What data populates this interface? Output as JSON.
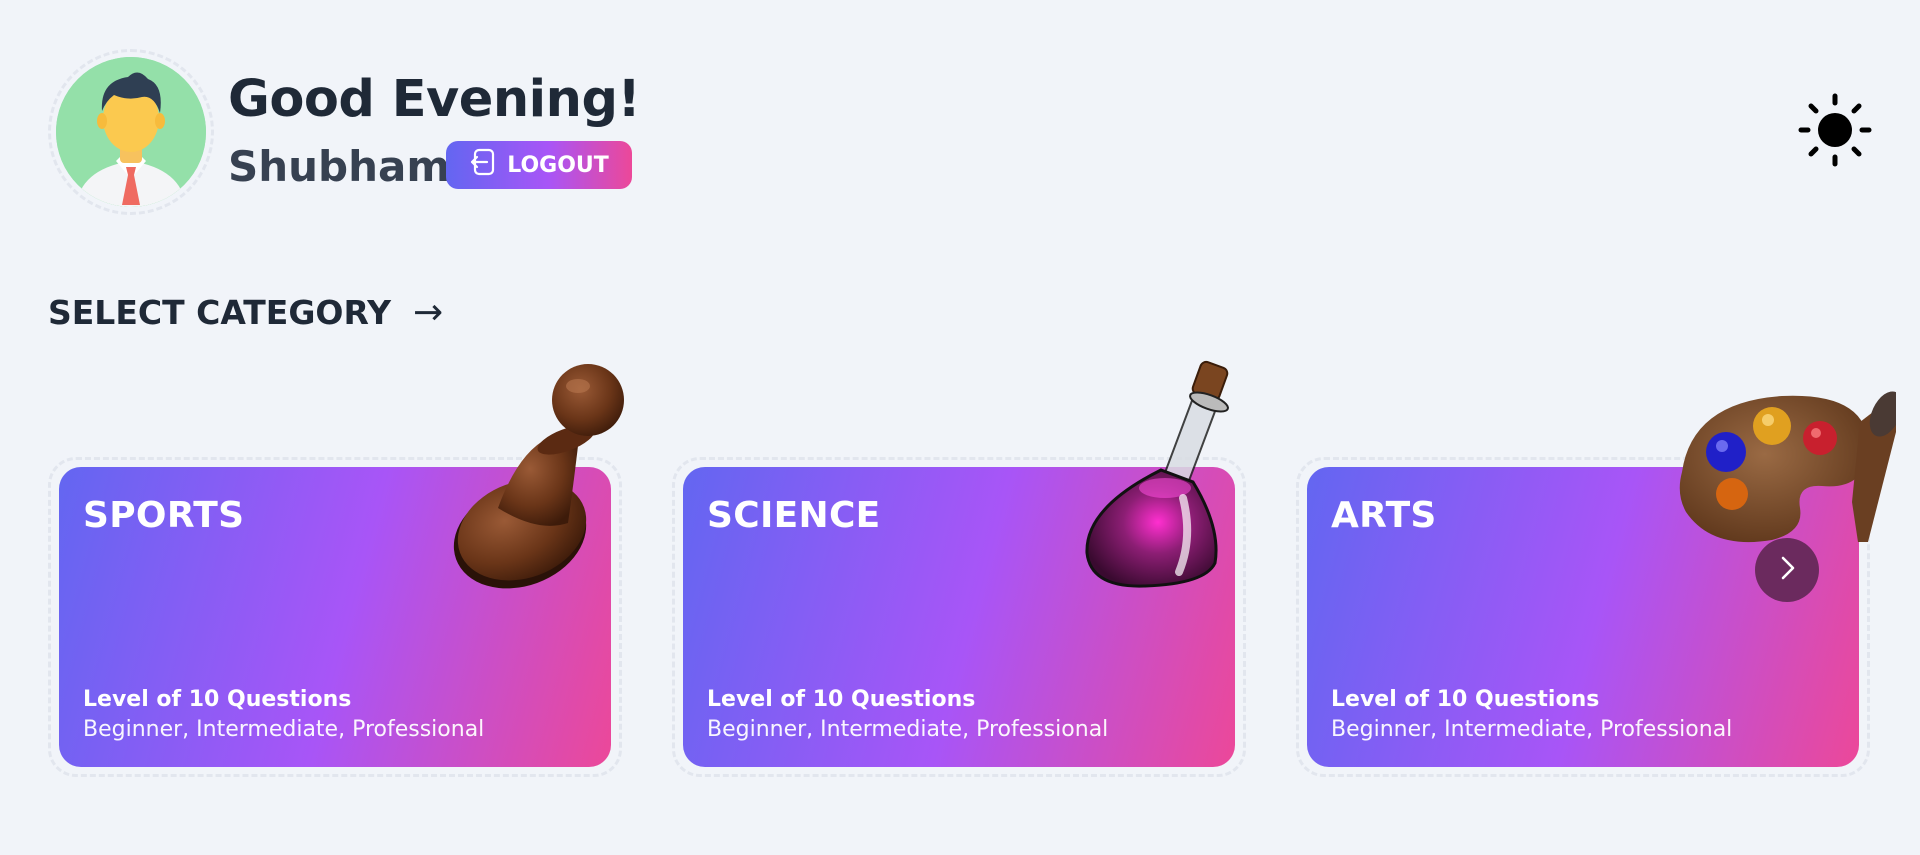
{
  "header": {
    "greeting": "Good Evening!",
    "username": "Shubham",
    "logout_label": "LOGOUT",
    "avatar_icon": "user-avatar",
    "theme_icon": "sun-icon"
  },
  "section": {
    "title": "SELECT CATEGORY",
    "arrow": "→"
  },
  "categories": [
    {
      "title": "SPORTS",
      "subtitle": "Level of 10 Questions",
      "levels": "Beginner, Intermediate, Professional",
      "icon": "chess-pawn-icon"
    },
    {
      "title": "SCIENCE",
      "subtitle": "Level of 10 Questions",
      "levels": "Beginner, Intermediate, Professional",
      "icon": "flask-icon"
    },
    {
      "title": "ARTS",
      "subtitle": "Level of 10 Questions",
      "levels": "Beginner, Intermediate, Professional",
      "icon": "paint-palette-icon"
    }
  ],
  "colors": {
    "background": "#f1f4f9",
    "gradient_start": "#6366f1",
    "gradient_mid": "#a855f7",
    "gradient_end": "#ec4899",
    "text_dark": "#1f2937"
  }
}
